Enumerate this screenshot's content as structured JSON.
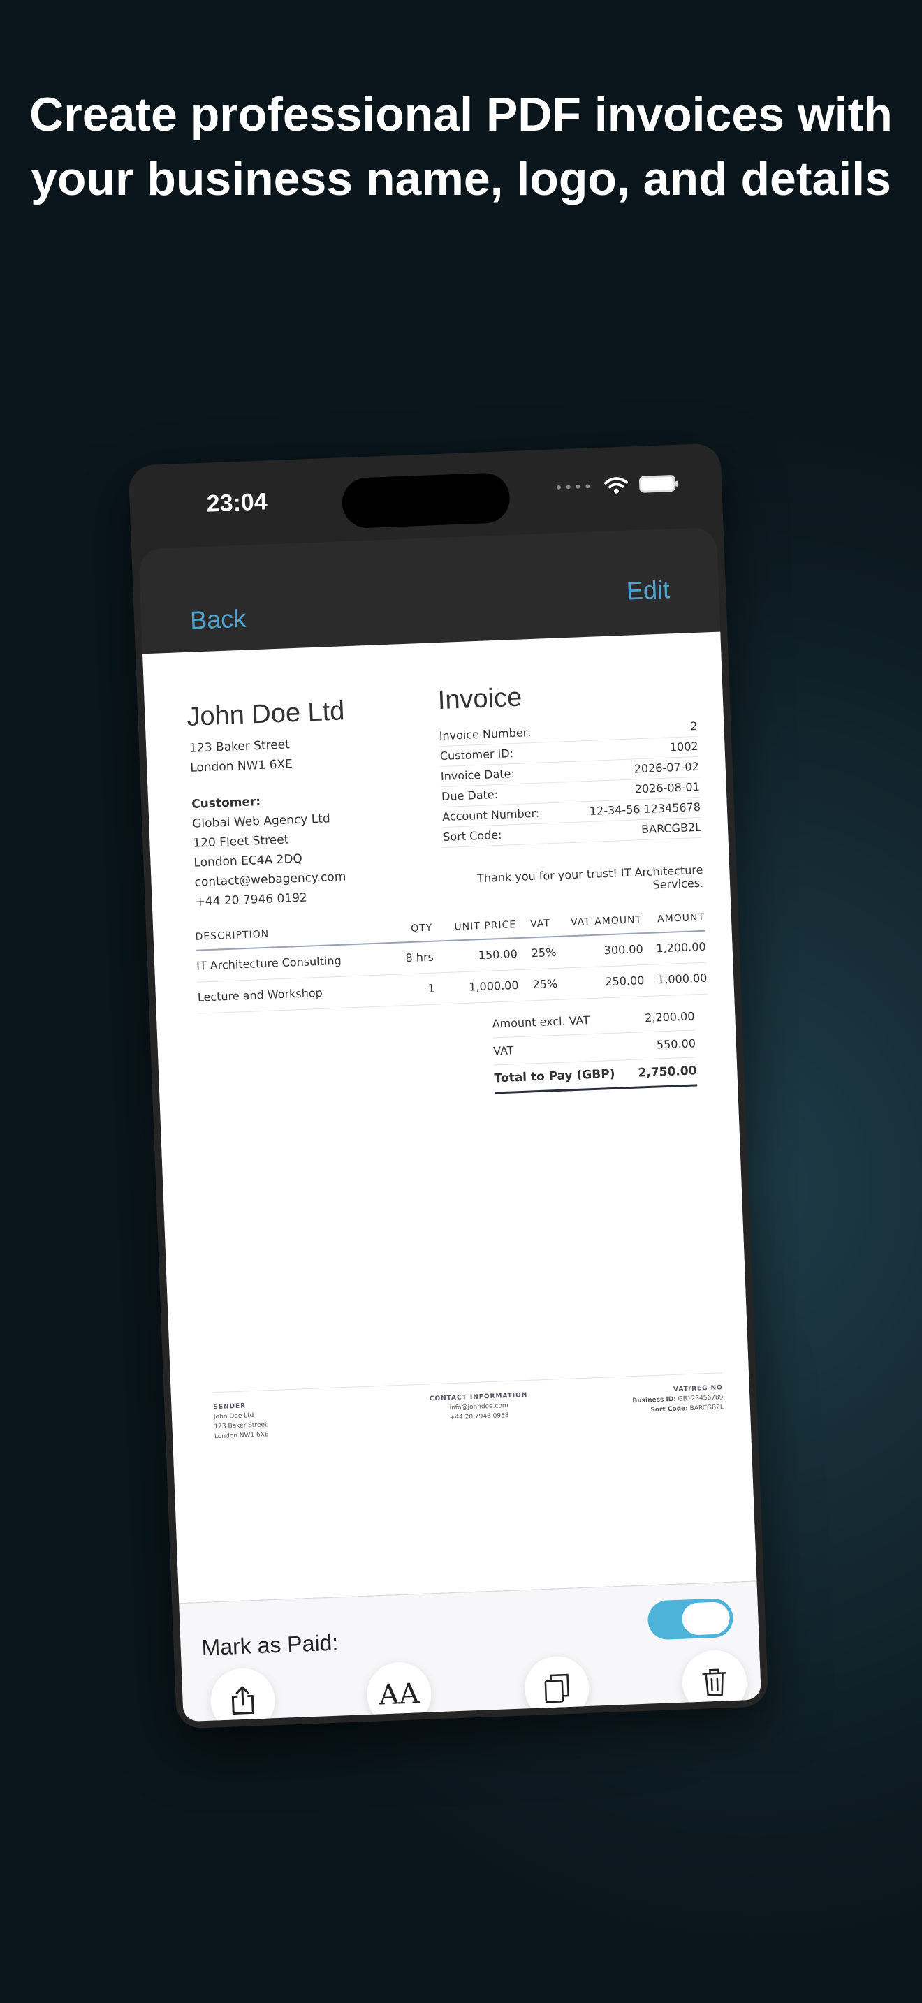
{
  "headline": {
    "line1": "Create professional PDF invoices with",
    "line2": "your business name, logo, and details"
  },
  "status_bar": {
    "time": "23:04",
    "signal": "••••"
  },
  "nav": {
    "back_label": "Back",
    "edit_label": "Edit"
  },
  "invoice": {
    "business_name": "John Doe Ltd",
    "business_address": [
      "123 Baker Street",
      "London NW1 6XE"
    ],
    "customer_label": "Customer:",
    "customer_lines": [
      "Global Web Agency Ltd",
      "120 Fleet Street",
      "London EC4A 2DQ",
      "contact@webagency.com",
      "+44 20 7946 0192"
    ],
    "title": "Invoice",
    "meta": [
      {
        "label": "Invoice Number:",
        "value": "2"
      },
      {
        "label": "Customer ID:",
        "value": "1002"
      },
      {
        "label": "Invoice Date:",
        "value": "2026-07-02"
      },
      {
        "label": "Due Date:",
        "value": "2026-08-01"
      },
      {
        "label": "Account Number:",
        "value": "12-34-56 12345678"
      },
      {
        "label": "Sort Code:",
        "value": "BARCGB2L"
      }
    ],
    "thanks": "Thank you for your trust! IT Architecture Services.",
    "columns": {
      "description": "DESCRIPTION",
      "qty": "QTY",
      "unit_price": "UNIT PRICE",
      "vat": "VAT",
      "vat_amount": "VAT AMOUNT",
      "amount": "AMOUNT"
    },
    "items": [
      {
        "description": "IT Architecture Consulting",
        "qty": "8 hrs",
        "unit_price": "150.00",
        "vat": "25%",
        "vat_amount": "300.00",
        "amount": "1,200.00"
      },
      {
        "description": "Lecture and Workshop",
        "qty": "1",
        "unit_price": "1,000.00",
        "vat": "25%",
        "vat_amount": "250.00",
        "amount": "1,000.00"
      }
    ],
    "totals": {
      "excl_label": "Amount excl. VAT",
      "excl_value": "2,200.00",
      "vat_label": "VAT",
      "vat_value": "550.00",
      "total_label": "Total to Pay (GBP)",
      "total_value": "2,750.00"
    },
    "footer": {
      "sender_label": "SENDER",
      "sender_lines": [
        "John Doe Ltd",
        "123 Baker Street",
        "London NW1 6XE"
      ],
      "contact_label": "CONTACT INFORMATION",
      "contact_lines": [
        "info@johndoe.com",
        "+44 20 7946 0958"
      ],
      "vat_label": "VAT/REG NO",
      "business_id_label": "Business ID:",
      "business_id": "GB123456789",
      "sort_code_label": "Sort Code:",
      "sort_code": "BARCGB2L"
    }
  },
  "bottom_bar": {
    "paid_label": "Mark as Paid:",
    "paid_on": true,
    "font_glyph": "AA"
  },
  "colors": {
    "accent": "#4fa5cf",
    "toggle_on": "#4db3d9"
  }
}
